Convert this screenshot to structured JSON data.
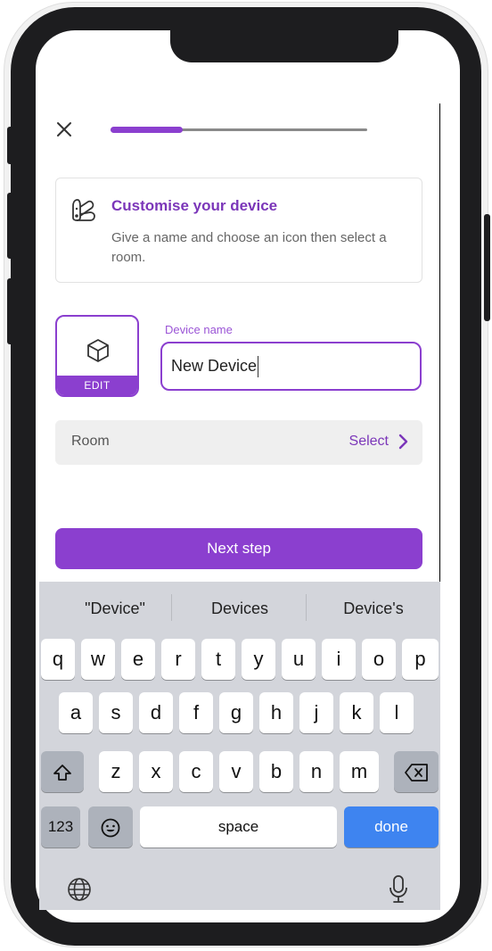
{
  "header": {
    "close_icon": "close-icon",
    "progress_fraction": 0.28
  },
  "info_card": {
    "title": "Customise your device",
    "subtitle": "Give a name and choose an icon then select a room.",
    "icon": "palette-icon"
  },
  "device_icon": {
    "icon": "cube-icon",
    "edit_label": "EDIT"
  },
  "device_name": {
    "label": "Device name",
    "value": "New Device"
  },
  "room": {
    "label": "Room",
    "select_label": "Select"
  },
  "next_button": {
    "label": "Next step"
  },
  "keyboard": {
    "suggestions": [
      "\"Device\"",
      "Devices",
      "Device's"
    ],
    "row1": [
      "q",
      "w",
      "e",
      "r",
      "t",
      "y",
      "u",
      "i",
      "o",
      "p"
    ],
    "row2": [
      "a",
      "s",
      "d",
      "f",
      "g",
      "h",
      "j",
      "k",
      "l"
    ],
    "row3": [
      "z",
      "x",
      "c",
      "v",
      "b",
      "n",
      "m"
    ],
    "numbers_label": "123",
    "space_label": "space",
    "done_label": "done",
    "shift_icon": "shift-icon",
    "backspace_icon": "backspace-icon",
    "emoji_icon": "emoji-icon",
    "globe_icon": "globe-icon",
    "mic_icon": "microphone-icon"
  },
  "colors": {
    "accent": "#8b3fcf",
    "done_blue": "#3e84f0",
    "keyboard_bg": "#d3d5db"
  }
}
